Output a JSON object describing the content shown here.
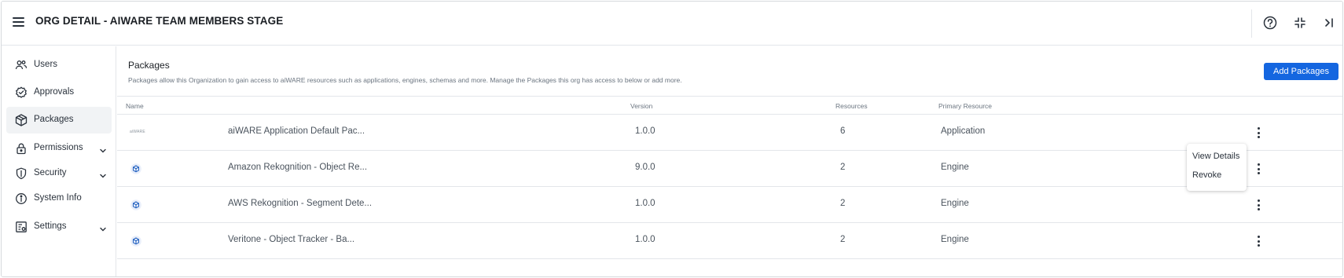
{
  "header": {
    "title": "ORG DETAIL - AIWARE TEAM MEMBERS STAGE",
    "icons": [
      "menu-icon",
      "help-icon",
      "collapse-icon",
      "panel-close-icon"
    ]
  },
  "sidebar": {
    "items": [
      {
        "label": "Users",
        "icon": "users-icon",
        "expandable": false,
        "active": false
      },
      {
        "label": "Approvals",
        "icon": "approvals-icon",
        "expandable": false,
        "active": false
      },
      {
        "label": "Packages",
        "icon": "package-icon",
        "expandable": false,
        "active": true
      },
      {
        "label": "Permissions",
        "icon": "lock-icon",
        "expandable": true,
        "active": false
      },
      {
        "label": "Security",
        "icon": "shield-icon",
        "expandable": true,
        "active": false
      },
      {
        "label": "System Info",
        "icon": "info-icon",
        "expandable": false,
        "active": false
      },
      {
        "label": "Settings",
        "icon": "settings-icon",
        "expandable": true,
        "active": false
      }
    ]
  },
  "main": {
    "section_title": "Packages",
    "section_description": "Packages allow this Organization to gain access to aiWARE resources such as applications, engines, schemas and more. Manage the Packages this org has access to below or add more.",
    "add_button_label": "Add Packages",
    "table": {
      "columns": [
        "Name",
        "Version",
        "Resources",
        "Primary Resource"
      ],
      "rows": [
        {
          "logo": "aiWARE",
          "name": "aiWARE Application Default Pac...",
          "version": "1.0.0",
          "resources": "6",
          "primary_resource": "Application"
        },
        {
          "logo": "package-icon",
          "name": "Amazon Rekognition - Object Re...",
          "version": "9.0.0",
          "resources": "2",
          "primary_resource": "Engine"
        },
        {
          "logo": "package-icon",
          "name": "AWS Rekognition - Segment Dete...",
          "version": "1.0.0",
          "resources": "2",
          "primary_resource": "Engine"
        },
        {
          "logo": "package-icon",
          "name": "Veritone - Object Tracker - Ba...",
          "version": "1.0.0",
          "resources": "2",
          "primary_resource": "Engine"
        }
      ]
    },
    "row_menu": {
      "items": [
        "View Details",
        "Revoke"
      ]
    }
  },
  "colors": {
    "accent": "#1466e0",
    "package_icon": "#1f5fbf",
    "active_nav_bg": "#f1f3f5"
  }
}
